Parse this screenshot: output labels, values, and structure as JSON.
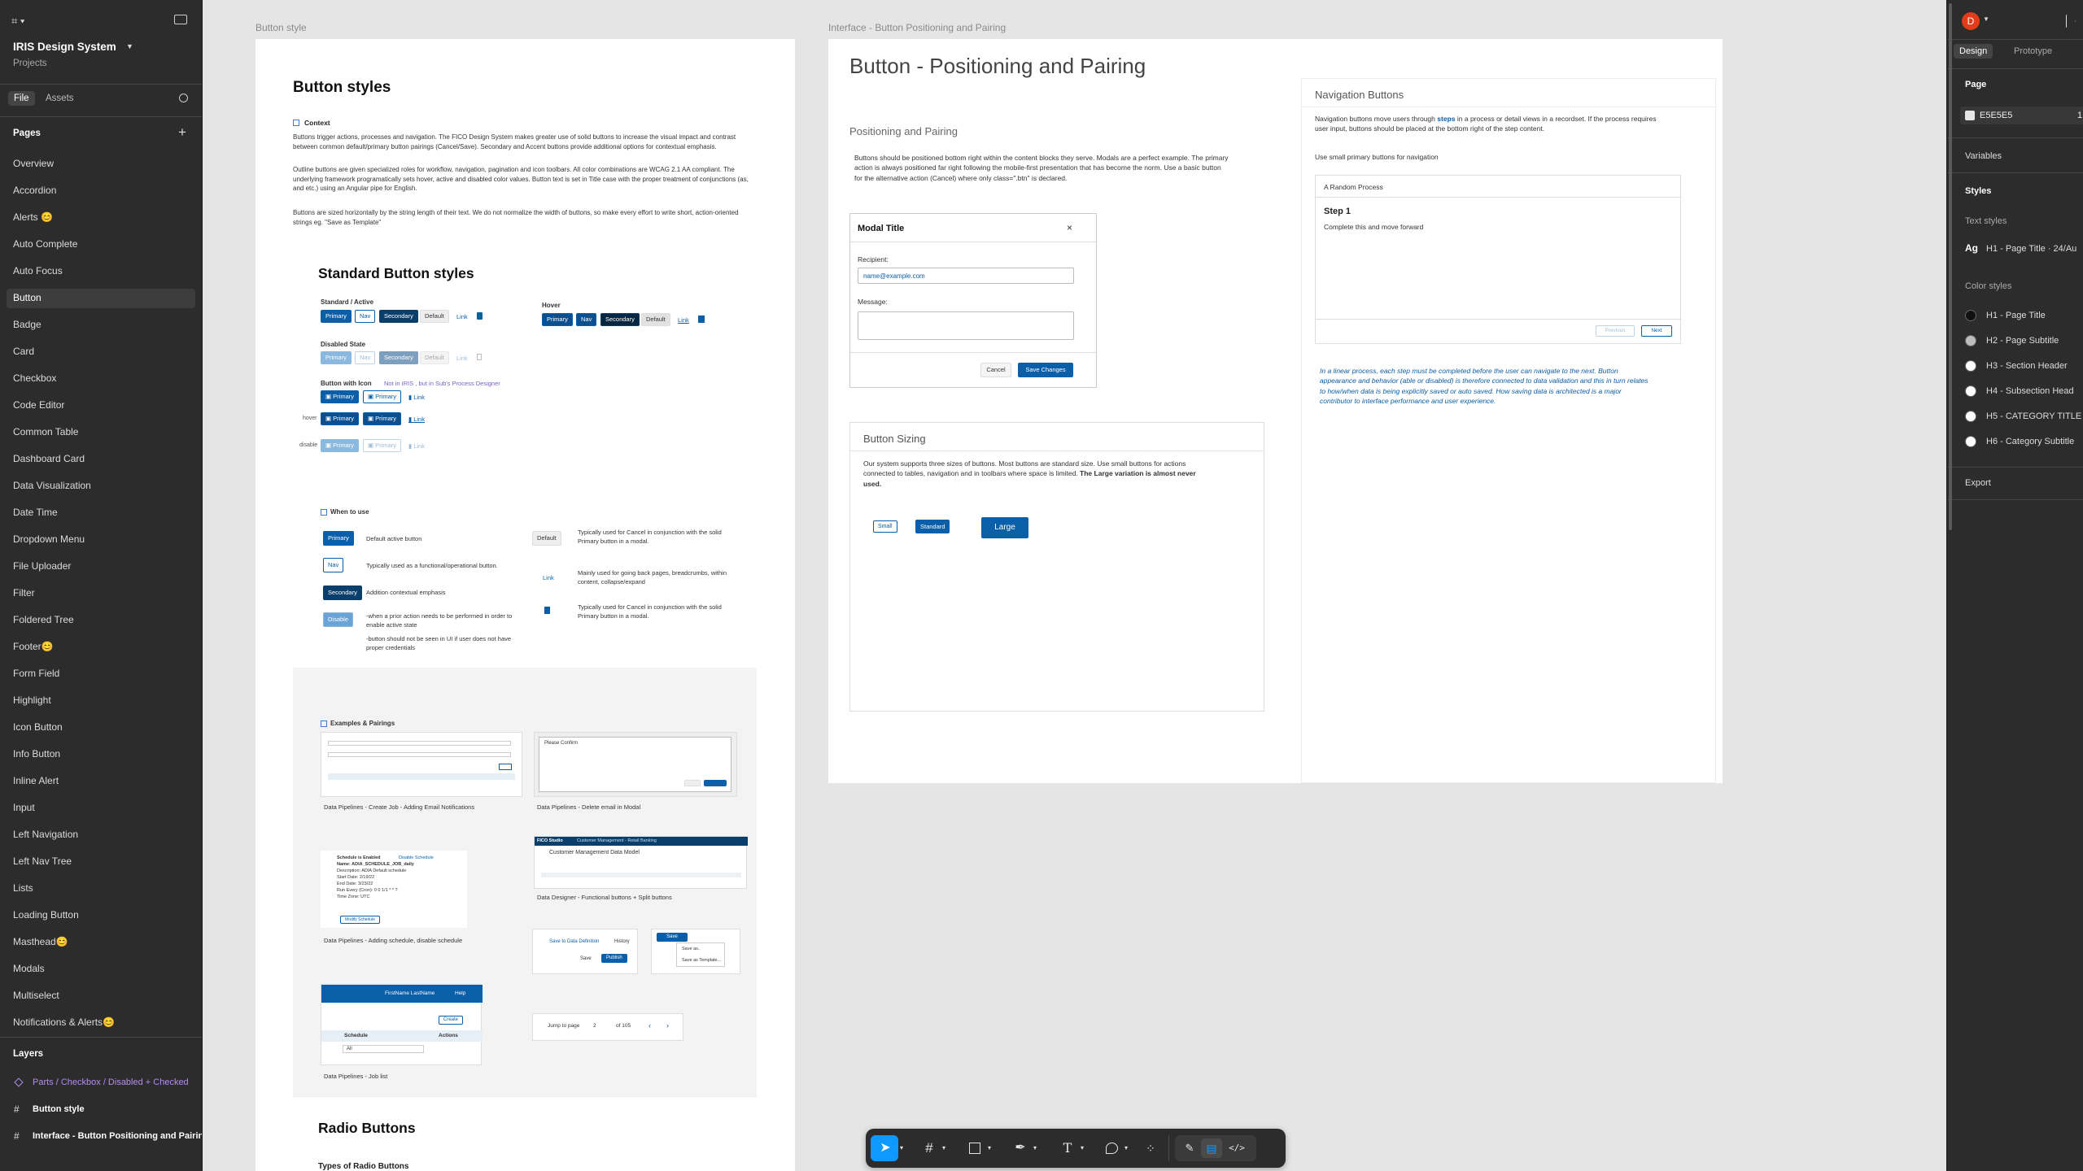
{
  "app": {
    "project_title": "IRIS Design System",
    "project_subtitle": "Projects",
    "tab_file": "File",
    "tab_assets": "Assets",
    "pages_header": "Pages",
    "layers_header": "Layers"
  },
  "pages": [
    "Overview",
    "Accordion",
    "Alerts 😊",
    "Auto Complete",
    "Auto Focus",
    "Button",
    "Badge",
    "Card",
    "Checkbox",
    "Code Editor",
    "Common Table",
    "Dashboard Card",
    "Data Visualization",
    "Date Time",
    "Dropdown Menu",
    "File Uploader",
    "Filter",
    "Foldered Tree",
    "Footer😊",
    "Form Field",
    "Highlight",
    "Icon Button",
    "Info Button",
    "Inline Alert",
    "Input",
    "Left Navigation",
    "Left Nav Tree",
    "Lists",
    "Loading Button",
    "Masthead😊",
    "Modals",
    "Multiselect",
    "Notifications & Alerts😊"
  ],
  "layers": [
    "Parts / Checkbox / Disabled + Checked",
    "Button style",
    "Interface - Button Positioning and Pairing"
  ],
  "right_panel": {
    "avatar": "D",
    "tab_design": "Design",
    "tab_prototype": "Prototype",
    "page_label": "Page",
    "page_color": "E5E5E5",
    "page_opacity": "1",
    "variables": "Variables",
    "styles": "Styles",
    "text_styles": "Text styles",
    "text_style_glyph": "Ag",
    "text_style_item": "H1 - Page Title · 24/Au",
    "color_styles": "Color styles",
    "color_items": [
      "H1 - Page Title",
      "H2 - Page Subtitle",
      "H3 - Section Header",
      "H4 - Subsection Head",
      "H5 - CATEGORY TITLE",
      "H6 - Category Subtitle"
    ],
    "export": "Export"
  },
  "frame1": {
    "label": "Button style",
    "title": "Button styles",
    "context_heading": "Context",
    "context_p1": "Buttons trigger actions, processes and navigation.  The FICO Design System makes greater use of solid buttons to increase the visual impact and contrast between common default/primary button pairings (Cancel/Save). Secondary and Accent buttons provide additional options for contextual emphasis.",
    "context_p2": "Outline buttons are given specialized roles for workflow, navigation, pagination and icon toolbars. All color combinations are WCAG 2.1 AA compliant. The underlying framework programatically sets hover, active and disabled color values.    Button text is set in Title case with the proper treatment of conjunctions (as, and etc.) using an Angular pipe for English.",
    "context_p3": "Buttons are sized horizontally by the string length of their text. We do not normalize the width of buttons, so make every effort to write short, action-oriented strings eg. \"Save as Template\"",
    "std_title": "Standard Button styles",
    "std_active": "Standard / Active",
    "hover": "Hover",
    "disabled_state": "Disabled State",
    "with_icon": "Button with Icon",
    "with_icon_note": "Not in IRIS , but in Sub's Process Designer",
    "lbl_primary": "Primary",
    "lbl_nav": "Nav",
    "lbl_secondary": "Secondary",
    "lbl_default": "Default",
    "lbl_link": "Link",
    "lbl_disable": "Disable",
    "row_hover": "hover",
    "row_disable": "disable",
    "when_heading": "When to use",
    "when_primary": "Default active button",
    "when_nav": "Typically used as a functional/operational button.",
    "when_secondary": "Addition contextual emphasis",
    "when_disable_1": "-when a prior action needs to be performed in order to enable active state",
    "when_disable_2": "-button should not be seen in UI if user does not have proper credentials",
    "when_default": "Typically used for Cancel in conjunction with the solid Primary button in a modal.",
    "when_link": "Mainly used for going back pages, breadcrumbs, within content, collapse/expand",
    "when_icon": "Typically used for Cancel in conjunction with the solid Primary button in a modal.",
    "examples_heading": "Examples & Pairings",
    "captions": [
      "Data Pipelines - Create Job - Adding Email Notifications",
      "Data Pipelines - Delete email in Modal",
      "Data Pipelines - Adding schedule, disable schedule",
      "Data Designer - Functional buttons + Split buttons",
      "Data Pipelines - Job list"
    ],
    "thumb_text": {
      "confirm": "Please Confirm",
      "fico": "FICO Studio",
      "cm": "Customer Management Data Model",
      "cm_crumb": "Customer Management - Retail Banking",
      "save_dd": "Save to Data Definition",
      "history": "History",
      "save": "Save",
      "publish": "Publish",
      "save_as": "Save as..",
      "save_tmpl": "Save as Template...",
      "user": "FirstName LastName",
      "help": "Help",
      "schedule": "Schedule",
      "actions": "Actions",
      "all": "All",
      "create": "Create",
      "jump": "Jump to page",
      "page_num": "2",
      "of": "of 105",
      "sched_lines": [
        "Schedule is Enabled",
        "Name: ADIA_SCHEDULE_JOB_daily",
        "Description: ADIA Default schedule",
        "Start Date: 2/19/22",
        "End Date: 3/23/22",
        "Run Every (Cron): 0 0 1/1 * * ?",
        "Time Zone: UTC"
      ],
      "modify": "Modify Schedule",
      "disable_sched": "Disable Schedule"
    },
    "radio_title": "Radio Buttons",
    "radio_sub": "Types of Radio Buttons"
  },
  "frame2": {
    "label": "Interface - Button Positioning and Pairing",
    "title": "Button - Positioning and Pairing",
    "pos_heading": "Positioning and Pairing",
    "pos_text": "Buttons should be positioned bottom right within the content blocks they serve. Modals are a perfect example. The primary action is always positioned far right following the mobile-first presentation that has become the norm. Use a basic button for the alternative action (Cancel) where only class=\".btn\" is declared.",
    "modal_title": "Modal Title",
    "modal_close": "×",
    "recipient": "Recipient:",
    "recipient_value": "name@example.com",
    "message": "Message:",
    "cancel": "Cancel",
    "save_changes": "Save Changes",
    "sizing_heading": "Button Sizing",
    "sizing_text": "Our system supports three sizes of buttons. Most buttons are standard size. Use small buttons for actions connected to tables, navigation and in toolbars where space is limited.",
    "sizing_bold": "The Large variation is almost never used.",
    "small": "Small",
    "standard": "Standard",
    "large": "Large",
    "nav_heading": "Navigation Buttons",
    "nav_text_a": "Navigation buttons move users through",
    "nav_text_link": "steps",
    "nav_text_b": "in a process or detail views in a recordset. If the process requires user input, buttons should be placed at the bottom right of the step content.",
    "nav_small": "Use small primary buttons for navigation",
    "random_process": "A Random Process",
    "step1": "Step 1",
    "step1_text": "Complete this and move forward",
    "previous": "Previous",
    "next": "Next",
    "linear_note": "In a linear process, each step must be completed before the user can navigate to the next. Button appearance and behavior (able or disabled) is therefore connected to data validation and this in turn relates to how/when data is being explicitly saved or auto saved. How saving data is architected is a major contributor to interface performance and user experience."
  },
  "toolbar": {
    "icons": [
      "move-tool",
      "frame-tool",
      "shape-tool",
      "pen-tool",
      "text-tool",
      "comment-tool",
      "actions-tool",
      "draw-mode",
      "design-mode",
      "dev-mode"
    ]
  }
}
